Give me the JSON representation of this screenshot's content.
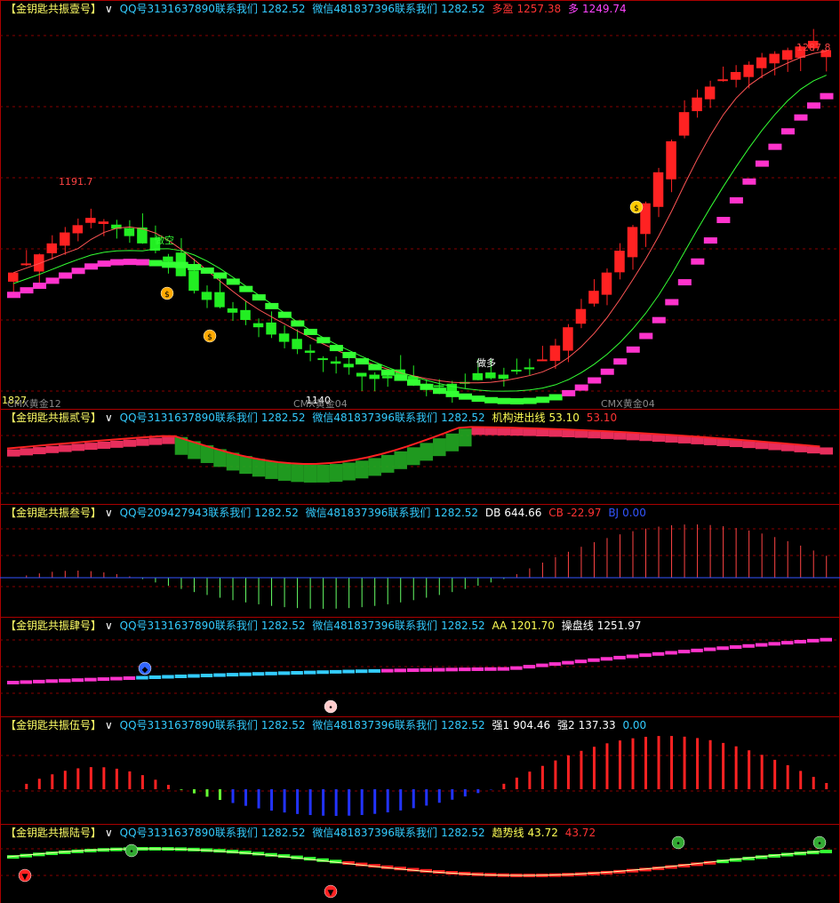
{
  "colors": {
    "up": "#ff2222",
    "down": "#22ee22",
    "pink": "#ff33cc",
    "greenline": "#33ff33",
    "divider": "#aa0000",
    "gridline": "#880000"
  },
  "panels": [
    {
      "title": "【金钥匙共振壹号】",
      "chevron": "∨",
      "contact_qq": "QQ号3131637890联系我们",
      "qq_val": "1282.52",
      "contact_wx": "微信481837396联系我们",
      "wx_val": "1282.52",
      "ind1_label": "多盈",
      "ind1_val": "1257.38",
      "ind2_label": "多",
      "ind2_val": "1249.74"
    },
    {
      "title": "【金钥匙共振贰号】",
      "chevron": "∨",
      "contact_qq": "QQ号3131637890联系我们",
      "qq_val": "1282.52",
      "contact_wx": "微信481837396联系我们",
      "wx_val": "1282.52",
      "ind1_label": "机构进出线",
      "ind1_val": "53.10",
      "ind2_val": "53.10"
    },
    {
      "title": "【金钥匙共振叁号】",
      "chevron": "∨",
      "contact_qq": "QQ号209427943联系我们",
      "qq_val": "1282.52",
      "contact_wx": "微信481837396联系我们",
      "wx_val": "1282.52",
      "ind1_label": "DB",
      "ind1_val": "644.66",
      "ind2_label": "CB",
      "ind2_val": "-22.97",
      "ind3_label": "BJ",
      "ind3_val": "0.00"
    },
    {
      "title": "【金钥匙共振肆号】",
      "chevron": "∨",
      "contact_qq": "QQ号3131637890联系我们",
      "qq_val": "1282.52",
      "contact_wx": "微信481837396联系我们",
      "wx_val": "1282.52",
      "ind1_label": "AA",
      "ind1_val": "1201.70",
      "ind2_label": "操盘线",
      "ind2_val": "1251.97"
    },
    {
      "title": "【金钥匙共振伍号】",
      "chevron": "∨",
      "contact_qq": "QQ号3131637890联系我们",
      "qq_val": "1282.52",
      "contact_wx": "微信481837396联系我们",
      "wx_val": "1282.52",
      "ind1_label": "强1",
      "ind1_val": "904.46",
      "ind2_label": "强2",
      "ind2_val": "137.33",
      "ind3_val": "0.00"
    },
    {
      "title": "【金钥匙共振陆号】",
      "chevron": "∨",
      "contact_qq": "QQ号3131637890联系我们",
      "qq_val": "1282.52",
      "contact_wx": "微信481837396联系我们",
      "wx_val": "1282.52",
      "ind1_label": "趋势线",
      "ind1_val": "43.72",
      "ind2_val": "43.72"
    }
  ],
  "main_chart": {
    "high_label": "1287.8",
    "peak_label": "1191.7",
    "low_label": "1140",
    "left_label": "1827",
    "signal_short": "做空",
    "signal_long": "做多",
    "contract_left": "CMX黄金12",
    "contract_mid": "CMX黄金04",
    "contract_right": "CMX黄金04"
  },
  "chart_data": {
    "type": "candlestick",
    "title": "CMX黄金",
    "high": 1287.8,
    "low": 1140,
    "marked_peak": 1191.7,
    "closes": [
      1160,
      1165,
      1170,
      1176,
      1182,
      1186,
      1190,
      1188,
      1184,
      1180,
      1176,
      1172,
      1166,
      1158,
      1150,
      1145,
      1141,
      1138,
      1134,
      1130,
      1126,
      1122,
      1118,
      1116,
      1113,
      1110,
      1108,
      1105,
      1104,
      1102,
      1101,
      1100,
      1099,
      1098,
      1099,
      1100,
      1101,
      1102,
      1104,
      1106,
      1108,
      1112,
      1120,
      1130,
      1140,
      1150,
      1160,
      1172,
      1185,
      1198,
      1215,
      1232,
      1248,
      1256,
      1262,
      1266,
      1270,
      1274,
      1278,
      1280,
      1282,
      1284,
      1283,
      1282
    ]
  },
  "icons": {
    "moneybag": "moneybag-icon",
    "dollar": "dollar-coin-icon",
    "bull": "bull-head-icon",
    "pig": "pig-head-icon",
    "frog": "frog-head-icon"
  }
}
